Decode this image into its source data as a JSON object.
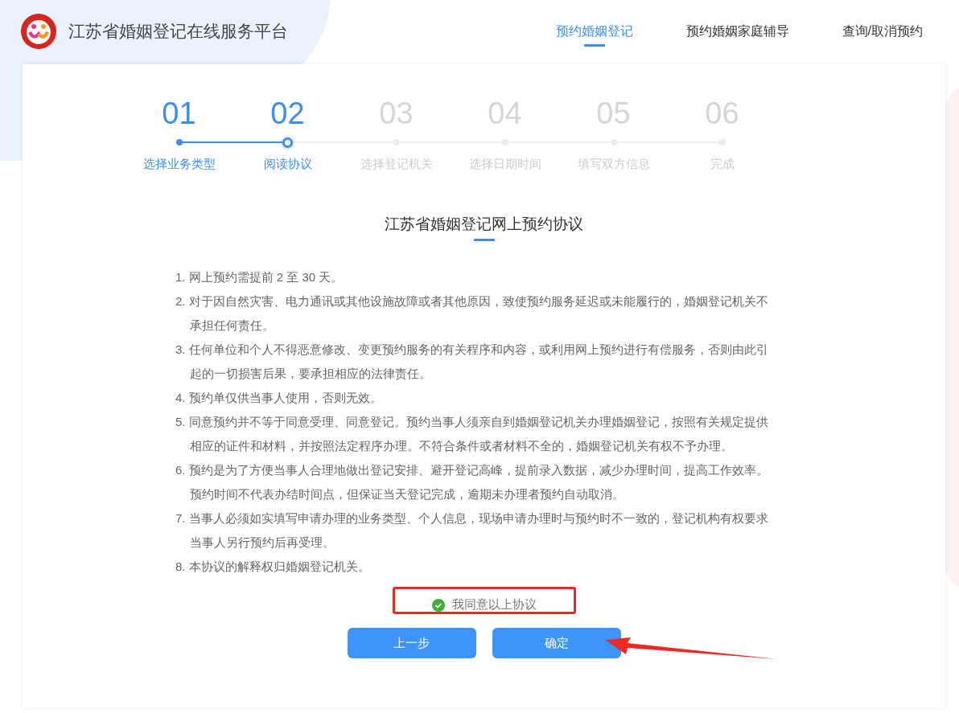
{
  "header": {
    "title": "江苏省婚姻登记在线服务平台",
    "nav": [
      {
        "label": "预约婚姻登记",
        "selected": true
      },
      {
        "label": "预约婚姻家庭辅导",
        "selected": false
      },
      {
        "label": "查询/取消预约",
        "selected": false
      }
    ]
  },
  "steps": [
    {
      "number": "01",
      "label": "选择业务类型",
      "completed": true,
      "selected": false
    },
    {
      "number": "02",
      "label": "阅读协议",
      "completed": false,
      "selected": true
    },
    {
      "number": "03",
      "label": "选择登记机关",
      "completed": false,
      "selected": false
    },
    {
      "number": "04",
      "label": "选择日期时间",
      "completed": false,
      "selected": false
    },
    {
      "number": "05",
      "label": "填写双方信息",
      "completed": false,
      "selected": false
    },
    {
      "number": "06",
      "label": "完成",
      "completed": false,
      "selected": false
    }
  ],
  "agreement": {
    "title": "江苏省婚姻登记网上预约协议",
    "items": [
      "1. 网上预约需提前 2 至 30 天。",
      "2. 对于因自然灾害、电力通讯或其他设施故障或者其他原因，致使预约服务延迟或未能履行的，婚姻登记机关不承担任何责任。",
      "3. 任何单位和个人不得恶意修改、变更预约服务的有关程序和内容，或利用网上预约进行有偿服务，否则由此引起的一切损害后果，要承担相应的法律责任。",
      "4. 预约单仅供当事人使用，否则无效。",
      "5. 同意预约并不等于同意受理、同意登记。预约当事人须亲自到婚姻登记机关办理婚姻登记，按照有关规定提供相应的证件和材料，并按照法定程序办理。不符合条件或者材料不全的，婚姻登记机关有权不予办理。",
      "6. 预约是为了方便当事人合理地做出登记安排、避开登记高峰，提前录入数据，减少办理时间，提高工作效率。预约时间不代表办结时间点，但保证当天登记完成，逾期未办理者预约自动取消。",
      "7. 当事人必须如实填写申请办理的业务类型、个人信息，现场申请办理时与预约时不一致的，登记机构有权要求当事人另行预约后再受理。",
      "8. 本协议的解释权归婚姻登记机关。"
    ],
    "consent": {
      "label": "我同意以上协议",
      "checked": true
    }
  },
  "buttons": [
    {
      "label": "上一步"
    },
    {
      "label": "确定"
    }
  ]
}
